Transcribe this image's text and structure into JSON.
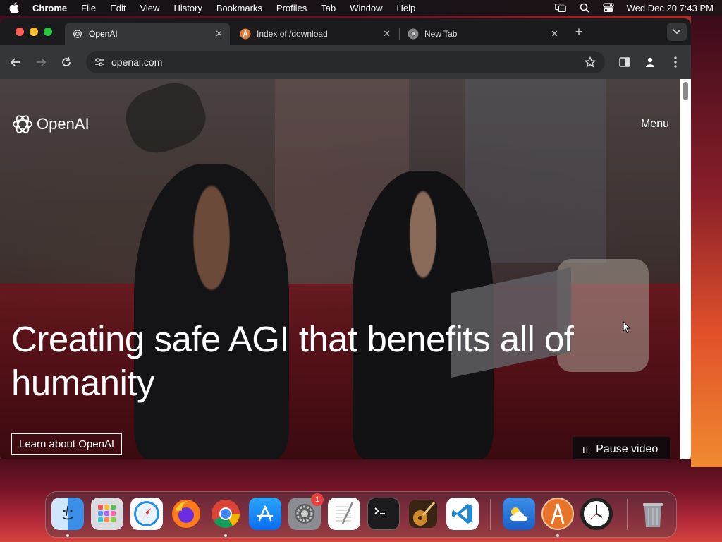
{
  "menubar": {
    "app_name": "Chrome",
    "items": [
      "File",
      "Edit",
      "View",
      "History",
      "Bookmarks",
      "Profiles",
      "Tab",
      "Window",
      "Help"
    ],
    "datetime": "Wed Dec 20  7:43 PM"
  },
  "browser": {
    "tabs": [
      {
        "title": "OpenAI",
        "active": true,
        "icon": "openai-icon"
      },
      {
        "title": "Index of /download",
        "active": false,
        "icon": "file-server-icon"
      },
      {
        "title": "New Tab",
        "active": false,
        "icon": "chrome-icon"
      }
    ],
    "address": "openai.com"
  },
  "page": {
    "logo_text": "OpenAI",
    "menu_label": "Menu",
    "headline_line1": "Creating safe AGI that benefits all of",
    "headline_line2": "humanity",
    "learn_button": "Learn about OpenAI",
    "pause_button": "Pause video",
    "pause_glyph": "II"
  },
  "dock": {
    "apps": [
      "finder",
      "launchpad",
      "safari",
      "firefox",
      "chrome",
      "app-store",
      "system-settings",
      "textedit",
      "terminal",
      "garageband",
      "vscode",
      "weather",
      "instruments",
      "clock",
      "trash"
    ],
    "settings_badge": "1"
  },
  "colors": {
    "accent_red": "#fe5f57",
    "accent_yellow": "#febc2e",
    "accent_green": "#28c840",
    "toolbar_bg": "#35363a"
  }
}
